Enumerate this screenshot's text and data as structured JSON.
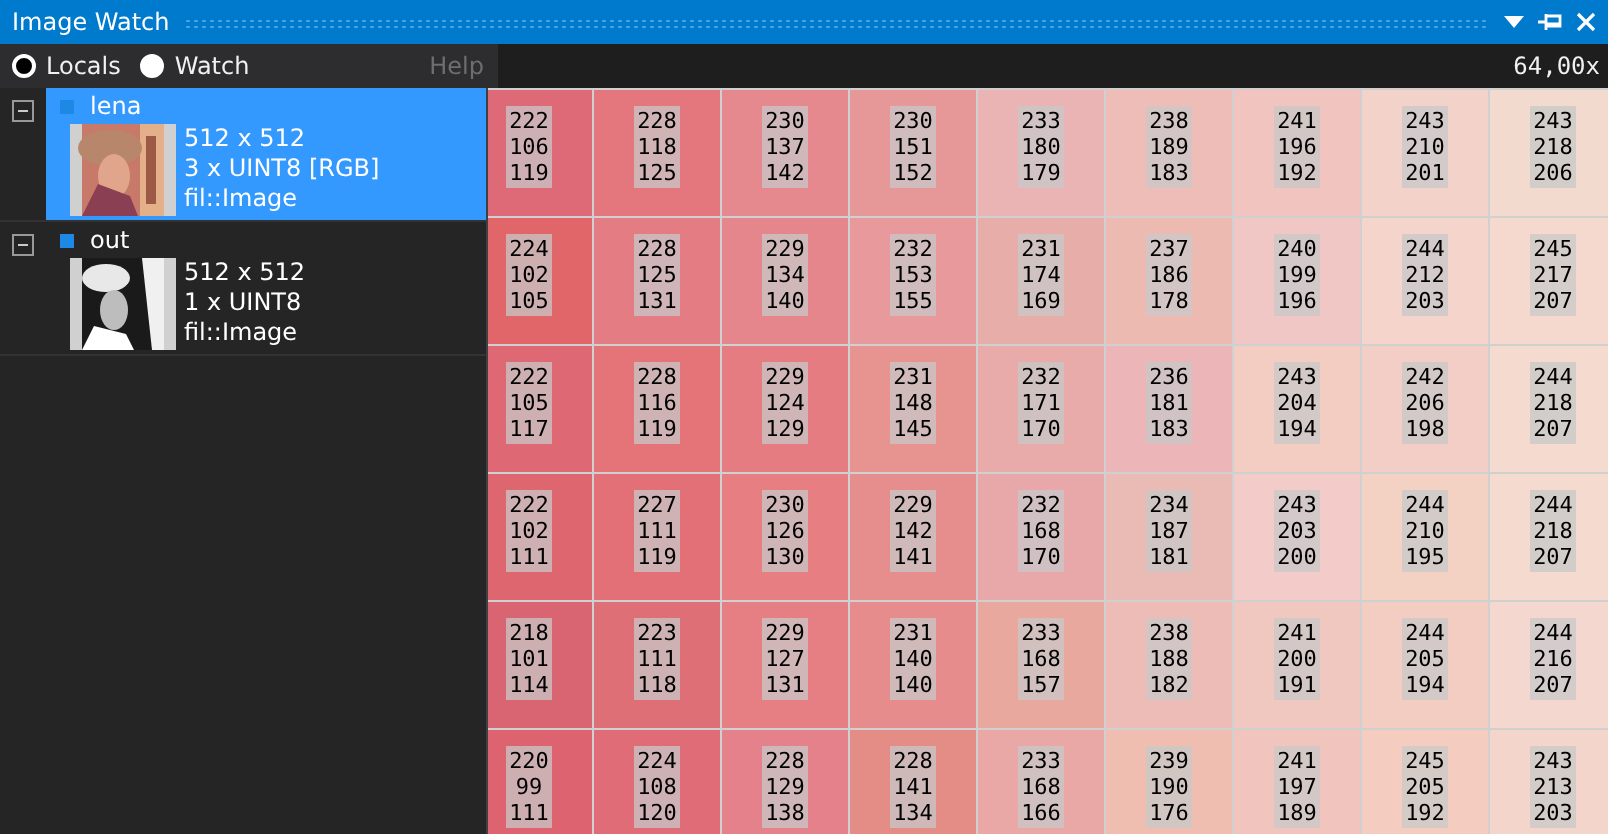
{
  "window": {
    "title": "Image Watch"
  },
  "views": [
    {
      "label": "Locals",
      "selected": true
    },
    {
      "label": "Watch",
      "selected": false
    }
  ],
  "help": "Help",
  "zoom": "64,00x",
  "images": [
    {
      "name": "lena",
      "expanded": true,
      "selected": true,
      "color": "#1e88e5",
      "lines": [
        "512 x 512",
        "3 x UINT8 [RGB]",
        "fil::Image"
      ]
    },
    {
      "name": "out",
      "expanded": true,
      "selected": false,
      "color": "#1e88e5",
      "lines": [
        "512 x 512",
        "1 x UINT8",
        "fil::Image"
      ]
    }
  ],
  "pixels": [
    [
      [
        "222",
        "106",
        "119"
      ],
      [
        "228",
        "118",
        "125"
      ],
      [
        "230",
        "137",
        "142"
      ],
      [
        "230",
        "151",
        "152"
      ],
      [
        "233",
        "180",
        "179"
      ],
      [
        "238",
        "189",
        "183"
      ],
      [
        "241",
        "196",
        "192"
      ],
      [
        "243",
        "210",
        "201"
      ],
      [
        "243",
        "218",
        "206"
      ]
    ],
    [
      [
        "224",
        "102",
        "105"
      ],
      [
        "228",
        "125",
        "131"
      ],
      [
        "229",
        "134",
        "140"
      ],
      [
        "232",
        "153",
        "155"
      ],
      [
        "231",
        "174",
        "169"
      ],
      [
        "237",
        "186",
        "178"
      ],
      [
        "240",
        "199",
        "196"
      ],
      [
        "244",
        "212",
        "203"
      ],
      [
        "245",
        "217",
        "207"
      ]
    ],
    [
      [
        "222",
        "105",
        "117"
      ],
      [
        "228",
        "116",
        "119"
      ],
      [
        "229",
        "124",
        "129"
      ],
      [
        "231",
        "148",
        "145"
      ],
      [
        "232",
        "171",
        "170"
      ],
      [
        "236",
        "181",
        "183"
      ],
      [
        "243",
        "204",
        "194"
      ],
      [
        "242",
        "206",
        "198"
      ],
      [
        "244",
        "218",
        "207"
      ]
    ],
    [
      [
        "222",
        "102",
        "111"
      ],
      [
        "227",
        "111",
        "119"
      ],
      [
        "230",
        "126",
        "130"
      ],
      [
        "229",
        "142",
        "141"
      ],
      [
        "232",
        "168",
        "170"
      ],
      [
        "234",
        "187",
        "181"
      ],
      [
        "243",
        "203",
        "200"
      ],
      [
        "244",
        "210",
        "195"
      ],
      [
        "244",
        "218",
        "207"
      ]
    ],
    [
      [
        "218",
        "101",
        "114"
      ],
      [
        "223",
        "111",
        "118"
      ],
      [
        "229",
        "127",
        "131"
      ],
      [
        "231",
        "140",
        "140"
      ],
      [
        "233",
        "168",
        "157"
      ],
      [
        "238",
        "188",
        "182"
      ],
      [
        "241",
        "200",
        "191"
      ],
      [
        "244",
        "205",
        "194"
      ],
      [
        "244",
        "216",
        "207"
      ]
    ],
    [
      [
        "220",
        "99",
        "111"
      ],
      [
        "224",
        "108",
        "120"
      ],
      [
        "228",
        "129",
        "138"
      ],
      [
        "228",
        "141",
        "134"
      ],
      [
        "233",
        "168",
        "166"
      ],
      [
        "239",
        "190",
        "176"
      ],
      [
        "241",
        "197",
        "189"
      ],
      [
        "245",
        "205",
        "192"
      ],
      [
        "243",
        "213",
        "203"
      ]
    ]
  ]
}
